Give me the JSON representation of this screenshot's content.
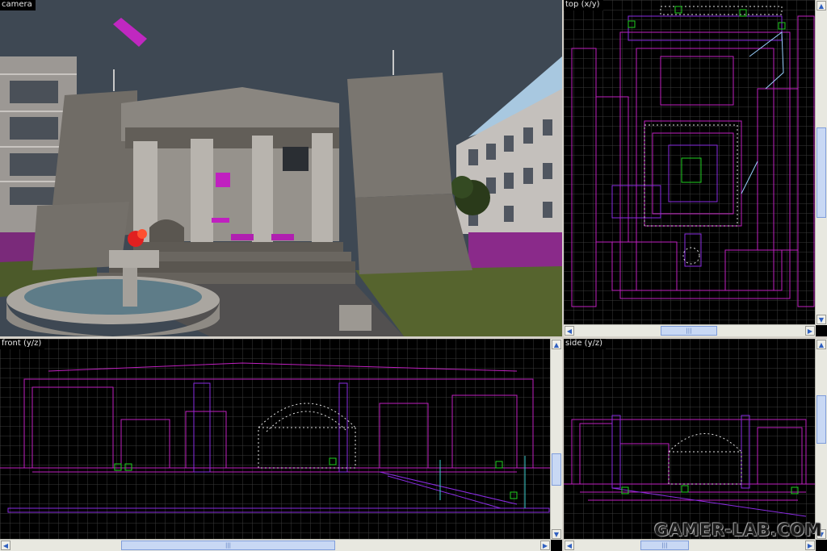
{
  "viewports": {
    "camera": {
      "label": "camera"
    },
    "top": {
      "label": "top (x/y)"
    },
    "front": {
      "label": "front (y/z)"
    },
    "side": {
      "label": "side (y/z)"
    }
  },
  "scrollbar": {
    "left_arrow": "◀",
    "right_arrow": "▶",
    "up_arrow": "▲",
    "down_arrow": "▼",
    "grip": "|||"
  },
  "watermark": {
    "text": "GAMER-LAB.COM"
  },
  "colors": {
    "grid": "#3a3a3a",
    "brush": "#c020c0",
    "brush_alt": "#8a2be2",
    "entity": "#e0e0e0",
    "selected": "#20d020",
    "sky": "#3c4650"
  }
}
